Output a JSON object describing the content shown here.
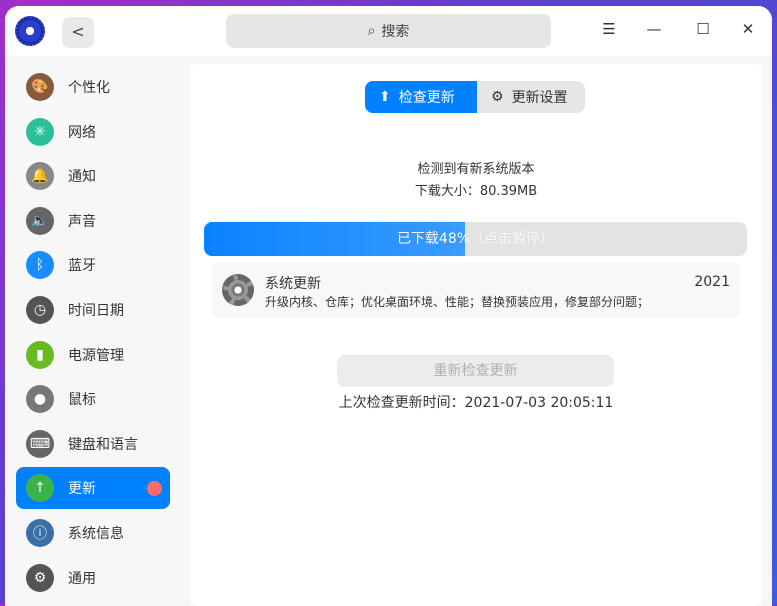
{
  "titlebar": {
    "search_placeholder": "搜索",
    "back": "<",
    "menu": "☰",
    "minimize": "—",
    "maximize": "☐",
    "close": "✕"
  },
  "sidebar": {
    "items": [
      {
        "label": "个性化",
        "icon": "palette-icon",
        "color": "#8a5a3c"
      },
      {
        "label": "网络",
        "icon": "network-icon",
        "color": "#2bbf9c"
      },
      {
        "label": "通知",
        "icon": "bell-icon",
        "color": "#888888"
      },
      {
        "label": "声音",
        "icon": "speaker-icon",
        "color": "#666666"
      },
      {
        "label": "蓝牙",
        "icon": "bluetooth-icon",
        "color": "#1a8cff"
      },
      {
        "label": "时间日期",
        "icon": "clock-icon",
        "color": "#555555"
      },
      {
        "label": "电源管理",
        "icon": "battery-icon",
        "color": "#66bb22"
      },
      {
        "label": "鼠标",
        "icon": "mouse-icon",
        "color": "#777777"
      },
      {
        "label": "键盘和语言",
        "icon": "keyboard-icon",
        "color": "#666666"
      },
      {
        "label": "更新",
        "icon": "update-icon",
        "color": "#3bb34a",
        "active": true
      },
      {
        "label": "系统信息",
        "icon": "system-info-icon",
        "color": "#3a6fa8"
      },
      {
        "label": "通用",
        "icon": "general-icon",
        "color": "#555555"
      }
    ]
  },
  "main": {
    "tabs": [
      {
        "label": "检查更新"
      },
      {
        "label": "更新设置"
      }
    ],
    "status": "检测到有新系统版本",
    "size": "下载大小：80.39MB",
    "progress": {
      "percent": 48,
      "label": "已下载48%（点击暂停）"
    },
    "update": {
      "title": "系统更新",
      "desc": "升级内核、仓库；优化桌面环境、性能；替换预装应用，修复部分问题；",
      "version": "2021"
    },
    "recheck": "重新检查更新",
    "last_check": "上次检查更新时间：2021-07-03 20:05:11"
  }
}
